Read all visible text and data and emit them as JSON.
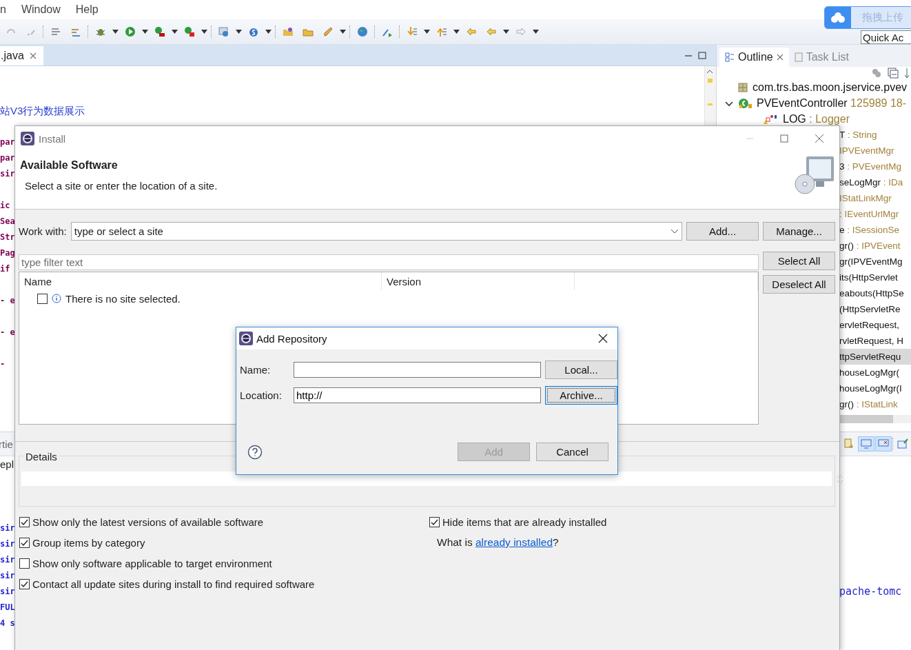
{
  "menu_bar": {
    "items": [
      {
        "label": "n"
      },
      {
        "label": "Window"
      },
      {
        "label": "Help"
      }
    ]
  },
  "upload_widget": {
    "label": "拖拽上传"
  },
  "quick_access": {
    "placeholder": "Quick Ac"
  },
  "editor": {
    "tab": {
      "label": ".java",
      "selected": true
    },
    "code_blocks": [
      [
        "站V3行为数据展示"
      ],
      [
        "par",
        "par",
        "sir"
      ],
      [
        "ic",
        "Sea",
        "Str",
        "Pag",
        "if"
      ],
      [
        "- e"
      ],
      [
        "- e"
      ],
      [
        "-"
      ]
    ]
  },
  "outline": {
    "tabs": [
      {
        "label": "Outline",
        "selected": true
      },
      {
        "label": "Task List",
        "selected": false
      }
    ],
    "tree": [
      {
        "kind": "package",
        "name": "com.trs.bas.moon.jservice.pvev"
      },
      {
        "kind": "class",
        "name": "PVEventController",
        "detail": "125989  18-",
        "expanded": true,
        "children": [
          {
            "kind": "field",
            "name": "LOG",
            "detail": ": Logger"
          }
        ]
      }
    ],
    "partial_rows": [
      {
        "name": "T",
        "detail": ": String",
        "selected": false
      },
      {
        "detail": "IPVEventMgr",
        "selected": false
      },
      {
        "name": "3",
        "detail": ": PVEventMg",
        "selected": false
      },
      {
        "name": "seLogMgr",
        "detail": ": IDa",
        "selected": false
      },
      {
        "detail": "IStatLinkMgr",
        "selected": false
      },
      {
        "detail": ": IEventUrlMgr",
        "selected": false
      },
      {
        "name": "e",
        "detail": ": ISessionSe",
        "selected": false
      },
      {
        "name": "gr()",
        "detail": ": IPVEvent",
        "selected": false
      },
      {
        "name": "gr(IPVEventMg",
        "selected": false
      },
      {
        "name": "its(HttpServlet",
        "selected": false
      },
      {
        "name": "eabouts(HttpSe",
        "selected": false
      },
      {
        "name": "(HttpServletRe",
        "selected": false
      },
      {
        "name": "ervletRequest,",
        "selected": false
      },
      {
        "name": "rvletRequest, H",
        "selected": false
      },
      {
        "name": "ttpServletRequ",
        "selected": true
      },
      {
        "name": "houseLogMgr(",
        "selected": false
      },
      {
        "name": "houseLogMgr(I",
        "selected": false
      },
      {
        "name": "gr()",
        "detail": ": IStatLink",
        "selected": false
      }
    ]
  },
  "bottom_panel": {
    "tab": {
      "label": "rtie"
    },
    "line": "epl",
    "console_lines": [
      {
        "text": "sir"
      },
      {
        "text": "sir"
      },
      {
        "text": "sir"
      },
      {
        "text": "sir"
      },
      {
        "text": "sir",
        "tail": "pache-tomc"
      },
      {
        "text": "FUL"
      },
      {
        "text": "4 s"
      }
    ]
  },
  "install_dialog": {
    "title": "Install",
    "heading": "Available Software",
    "description": "Select a site or enter the location of a site.",
    "work_with": {
      "label": "Work with:",
      "value": "type or select a site"
    },
    "add_button": "Add...",
    "manage_button": "Manage...",
    "filter": {
      "placeholder": "type filter text"
    },
    "select_all_button": "Select All",
    "deselect_all_button": "Deselect All",
    "table": {
      "columns": [
        "Name",
        "Version"
      ],
      "rows": [
        {
          "text": "There is no site selected.",
          "checked": false
        }
      ]
    },
    "details": {
      "label": "Details"
    },
    "options": [
      {
        "label": "Show only the latest versions of available software",
        "checked": true
      },
      {
        "label": "Group items by category",
        "checked": true
      },
      {
        "label": "Show only software applicable to target environment",
        "checked": false
      },
      {
        "label": "Contact all update sites during install to find required software",
        "checked": true
      }
    ],
    "hide_installed": {
      "label": "Hide items that are already installed",
      "checked": true
    },
    "installed_link": {
      "text": "What is ",
      "link": "already installed",
      "suffix": "?"
    }
  },
  "add_repository_dialog": {
    "title": "Add Repository",
    "fields": [
      {
        "label": "Name:",
        "button": {
          "label": "Local...",
          "focused": false
        }
      },
      {
        "label": "Location:",
        "value": "http://",
        "button": {
          "label": "Archive...",
          "focused": true
        }
      }
    ],
    "add_button": {
      "label": "Add",
      "disabled": true
    },
    "cancel_button": {
      "label": "Cancel",
      "disabled": false
    }
  }
}
